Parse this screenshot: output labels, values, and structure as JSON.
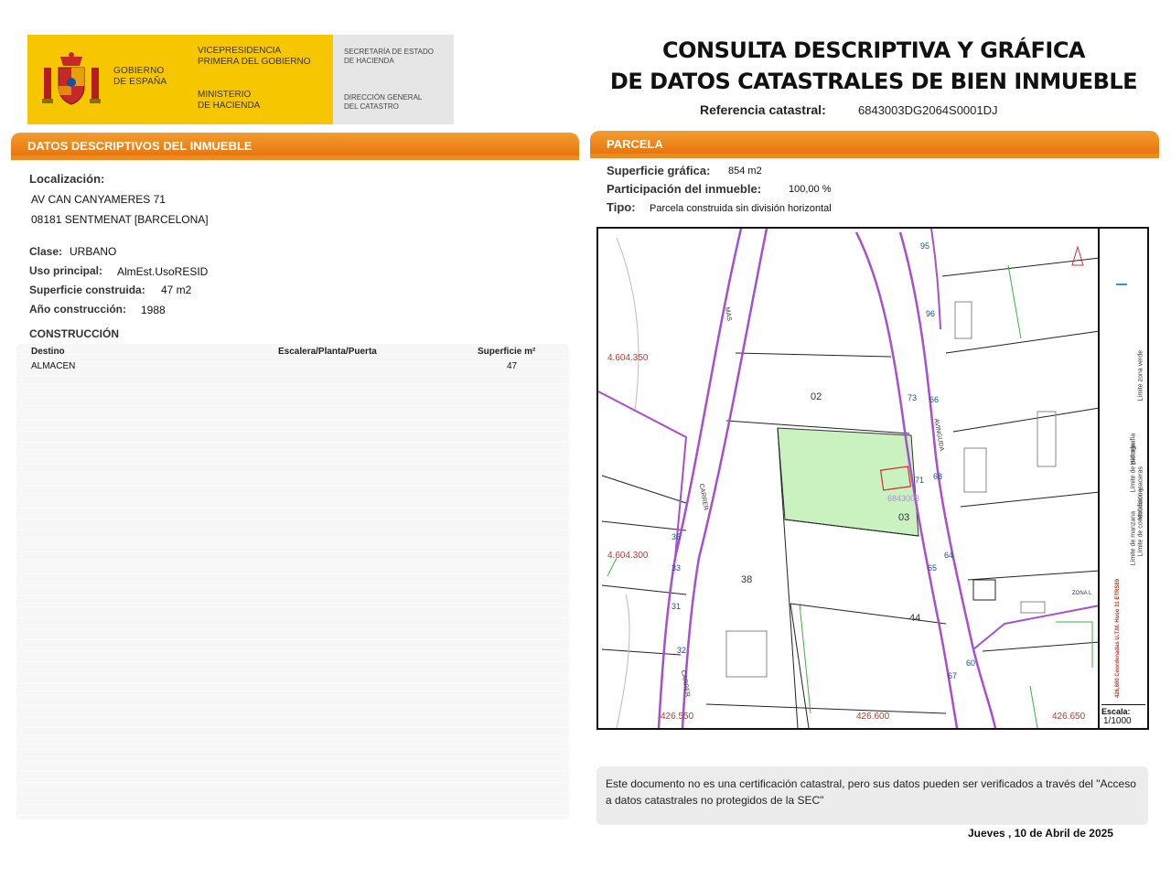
{
  "header": {
    "gov_name_1": "GOBIERNO",
    "gov_name_2": "DE ESPAÑA",
    "vice_1": "VICEPRESIDENCIA",
    "vice_2": "PRIMERA DEL GOBIERNO",
    "minis_1": "MINISTERIO",
    "minis_2": "DE HACIENDA",
    "secret_1": "SECRETARÍA DE ESTADO",
    "secret_2": "DE HACIENDA",
    "dgc_1": "DIRECCIÓN GENERAL",
    "dgc_2": "DEL CATASTRO",
    "title_line1": "CONSULTA DESCRIPTIVA Y GRÁFICA",
    "title_line2": "DE DATOS CATASTRALES DE BIEN INMUEBLE",
    "ref_label": "Referencia catastral:",
    "ref_value": "6843003DG2064S0001DJ"
  },
  "left": {
    "bar_title": "DATOS DESCRIPTIVOS DEL INMUEBLE",
    "loc_label": "Localización:",
    "loc_line1": "AV CAN CANYAMERES 71",
    "loc_line2": "08181 SENTMENAT [BARCELONA]",
    "clase_label": "Clase:",
    "clase_value": "URBANO",
    "uso_label": "Uso principal:",
    "uso_value": "AlmEst.UsoRESID",
    "sup_label": "Superficie construida:",
    "sup_value": "47 m2",
    "anio_label": "Año construcción:",
    "anio_value": "1988",
    "construccion_label": "CONSTRUCCIÓN",
    "table": {
      "headers": [
        "Destino",
        "Escalera/Planta/Puerta",
        "Superficie m²"
      ],
      "rows": [
        [
          "ALMACEN",
          "",
          "47"
        ]
      ]
    }
  },
  "right": {
    "bar_title": "PARCELA",
    "supg_label": "Superficie gráfica:",
    "supg_value": "854 m2",
    "part_label": "Participación del inmueble:",
    "part_value": "100,00 %",
    "tipo_label": "Tipo:",
    "tipo_value": "Parcela construida sin división horizontal"
  },
  "map": {
    "coord_left_top": "4.604.350",
    "coord_left_mid": "4.604.300",
    "coord_bottom_1": "426.550",
    "coord_bottom_2": "426.600",
    "coord_bottom_3": "426.650",
    "parcel_labels": [
      "02",
      "03",
      "38",
      "44"
    ],
    "parcel_ref": "6843003",
    "street_1": "MAS",
    "street_2": "CARRER",
    "street_3": "AVINGUDA",
    "street_4": "CARRER",
    "house_numbers_right": [
      "95",
      "96",
      "66",
      "73",
      "71",
      "68",
      "64",
      "65",
      "67",
      "60"
    ],
    "house_numbers_left": [
      "35",
      "33",
      "31",
      "32"
    ],
    "scale_label": "Escala:",
    "scale_value": "1/1000",
    "legend": [
      "Hidrografía",
      "Límite zona verde",
      "Límite de parcela",
      "Mobiliario y aceras",
      "Límite de manzana",
      "Límite de construcciones"
    ],
    "coord_note": "426,600 Coordenadas U.T.M. Huso 31 ETRS89",
    "zona_label": "ZONA L"
  },
  "footer": {
    "note": "Este documento no es una certificación catastral, pero sus datos pueden ser verificados a través del \"Acceso a datos catastrales no protegidos de la SEC\"",
    "date": "Jueves , 10 de Abril de 2025"
  }
}
